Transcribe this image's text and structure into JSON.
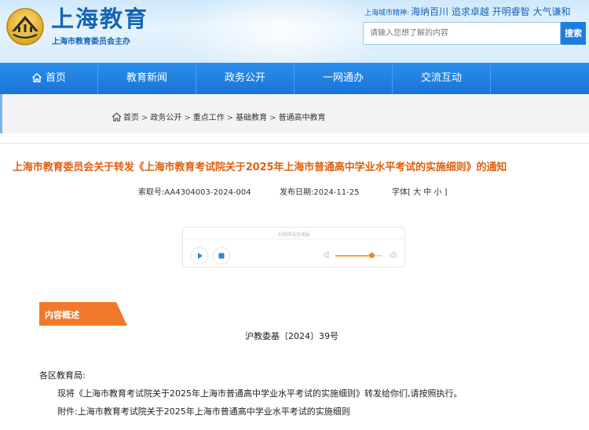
{
  "header": {
    "site_title": "上海教育",
    "site_subtitle": "上海市教育委员会主办",
    "slogan_prefix": "上海城市精神:",
    "slogan": "海纳百川 追求卓越 开明睿智 大气谦和",
    "search": {
      "placeholder": "请输入您想了解的内容",
      "button_label": "搜索"
    }
  },
  "nav": {
    "items": [
      {
        "label": "首页"
      },
      {
        "label": "教育新闻"
      },
      {
        "label": "政务公开"
      },
      {
        "label": "一网通办"
      },
      {
        "label": "交流互动"
      }
    ]
  },
  "breadcrumb": [
    "首页",
    "政务公开",
    "重点工作",
    "基础教育",
    "普通高中教育"
  ],
  "article": {
    "title": "上海市教育委员会关于转发《上海市教育考试院关于2025年上海市普通高中学业水平考试的实施细则》的通知",
    "index_label": "索取号:",
    "index_value": "AA4304003-2024-004",
    "date_label": "发布日期:",
    "date_value": "2024-11-25",
    "font_label": "字体[",
    "font_options": [
      "大",
      "中",
      "小"
    ],
    "font_close": "]"
  },
  "player": {
    "hint": "无障碍语音播报",
    "volume": 0.78
  },
  "section_tag": "内容概述",
  "doc_number": "沪教委基〔2024〕39号",
  "body": {
    "salutation": "各区教育局:",
    "paragraph1": "现将《上海市教育考试院关于2025年上海市普通高中学业水平考试的实施细则》转发给你们,请按照执行。",
    "attachment": "附件:上海市教育考试院关于2025年上海市普通高中学业水平考试的实施细则"
  },
  "colors": {
    "brand_blue": "#1665b7",
    "nav_blue": "#1f7fe0",
    "title_orange": "#e0600e",
    "tag_orange": "#f07a2a"
  }
}
